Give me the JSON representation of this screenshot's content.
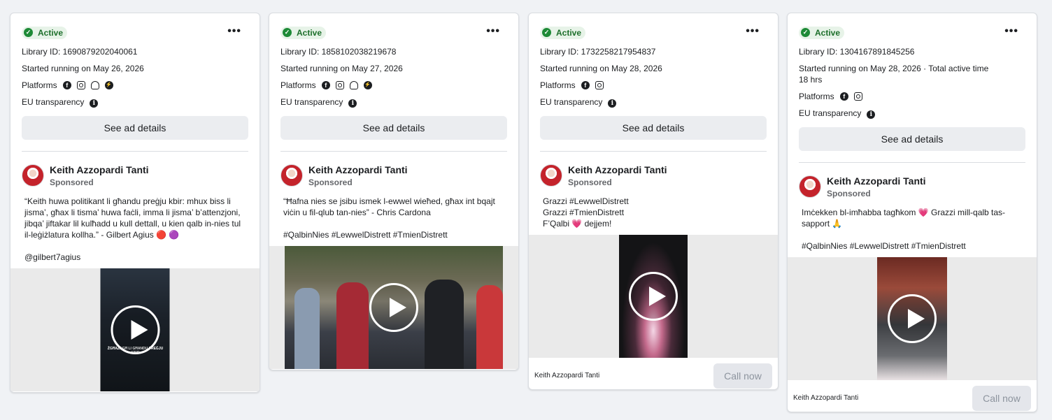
{
  "common": {
    "active_label": "Active",
    "platforms_label": "Platforms",
    "eu_label": "EU transparency",
    "details_button": "See ad details",
    "advertiser_name": "Keith Azzopardi Tanti",
    "sponsored_label": "Sponsored",
    "call_button": "Call now",
    "more_glyph": "•••"
  },
  "cards": [
    {
      "library_id": "Library ID: 1690879202040061",
      "started": "Started running on May 26, 2026",
      "platforms": [
        "facebook-icon",
        "instagram-icon",
        "audience-network-icon",
        "messenger-icon"
      ],
      "body_lines": [
        "“Keith huwa politikant li għandu preġju kbir: mhux biss li",
        "jisma’, għax li tisma’ huwa faċli, imma li jisma’ b’attenzjoni,",
        "jibqa’ jiftakar lil kulħadd u kull dettall, u kien qalb in-nies tul",
        "il-leġiżlatura kollha.” - Gilbert Agius 🔴 🟣",
        "",
        "@gilbert7agius"
      ],
      "video_overlay": "ŻGĦAŻAGĦ LI GĦANDU PREĠJU KBIR"
    },
    {
      "library_id": "Library ID: 1858102038219678",
      "started": "Started running on May 27, 2026",
      "platforms": [
        "facebook-icon",
        "instagram-icon",
        "audience-network-icon",
        "messenger-icon"
      ],
      "body_lines": [
        "“Ħafna nies se jsibu ismek l-ewwel wieħed, għax int bqajt",
        "viċin u fil-qlub tan-nies” - Chris Cardona",
        "",
        "#QalbinNies #LewwelDistrett #TmienDistrett"
      ]
    },
    {
      "library_id": "Library ID: 1732258217954837",
      "started": "Started running on May 28, 2026",
      "platforms": [
        "facebook-icon",
        "instagram-icon"
      ],
      "body_lines": [
        "Grazzi #LewwelDistrett",
        "Grazzi #TmienDistrett",
        "F’Qalbi 💗 dejjem!"
      ],
      "footer_name": "Keith Azzopardi Tanti"
    },
    {
      "library_id": "Library ID: 1304167891845256",
      "started": "Started running on May 28, 2026 · Total active time",
      "started_2": "18 hrs",
      "platforms": [
        "facebook-icon",
        "instagram-icon"
      ],
      "body_lines": [
        "Imċekken bl-imħabba tagħkom 💗 Grazzi mill-qalb tas-",
        "sapport 🙏",
        "",
        "#QalbinNies #LewwelDistrett #TmienDistrett"
      ],
      "footer_name": "Keith Azzopardi Tanti"
    }
  ],
  "colors": {
    "active_bg": "#e7f3e8",
    "active_text": "#1d6f2b",
    "button_bg": "#ebedf0",
    "page_bg": "#f0f2f5"
  }
}
